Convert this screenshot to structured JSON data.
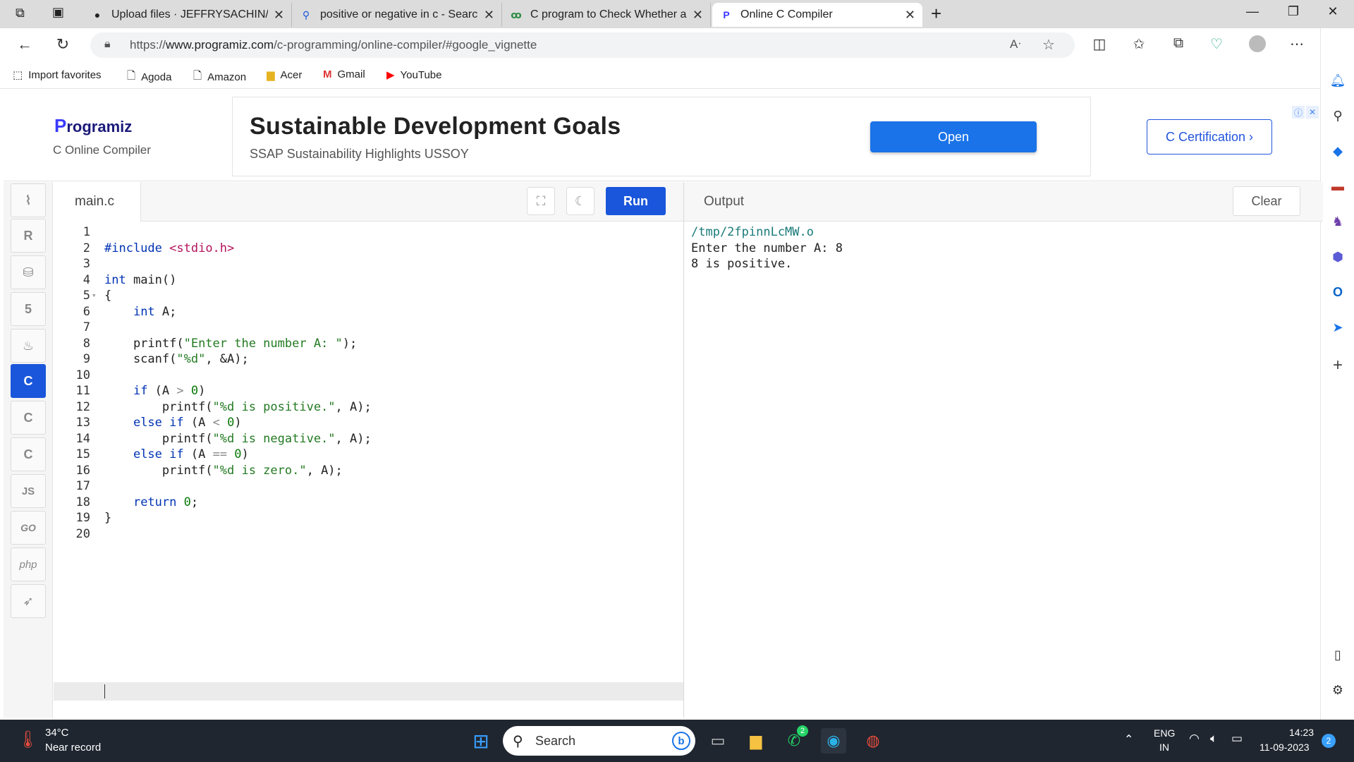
{
  "browser": {
    "tabs": [
      {
        "title": "Upload files · JEFFRYSACHIN/C-p",
        "icon": "github-icon"
      },
      {
        "title": "positive or negative in c - Search",
        "icon": "search-icon"
      },
      {
        "title": "C program to Check Whether a N",
        "icon": "gfg-icon"
      },
      {
        "title": "Online C Compiler",
        "icon": "programiz-icon"
      }
    ],
    "url_prefix": "https://",
    "url_domain": "www.programiz.com",
    "url_path": "/c-programming/online-compiler/#google_vignette",
    "favorites": [
      "Import favorites",
      "Agoda",
      "Amazon",
      "Acer",
      "Gmail",
      "YouTube"
    ]
  },
  "site": {
    "logo_letter": "P",
    "logo_rest": "rogramiz",
    "logo_subtitle": "C Online Compiler",
    "ad_title": "Sustainable Development Goals",
    "ad_subtitle": "SSAP Sustainability Highlights USSOY",
    "ad_button": "Open",
    "certification_button": "C Certification ›"
  },
  "languages": [
    "python",
    "r",
    "sql",
    "html",
    "java",
    "c",
    "cpp",
    "csharp",
    "JS",
    "GO",
    "php",
    "swift"
  ],
  "editor": {
    "filename": "main.c",
    "run_label": "Run",
    "line_numbers": [
      "1",
      "2",
      "3",
      "4",
      "5",
      "6",
      "7",
      "8",
      "9",
      "10",
      "11",
      "12",
      "13",
      "14",
      "15",
      "16",
      "17",
      "18",
      "19",
      "20"
    ]
  },
  "output": {
    "title": "Output",
    "clear_label": "Clear",
    "lines": [
      "/tmp/2fpinnLcMW.o",
      "Enter the number A: 8",
      "8 is positive."
    ]
  },
  "taskbar": {
    "temperature": "34°C",
    "weather": "Near record",
    "search_placeholder": "Search",
    "lang1": "ENG",
    "lang2": "IN",
    "time": "14:23",
    "date": "11-09-2023",
    "notif_count": "2",
    "whatsapp_badge": "2"
  }
}
